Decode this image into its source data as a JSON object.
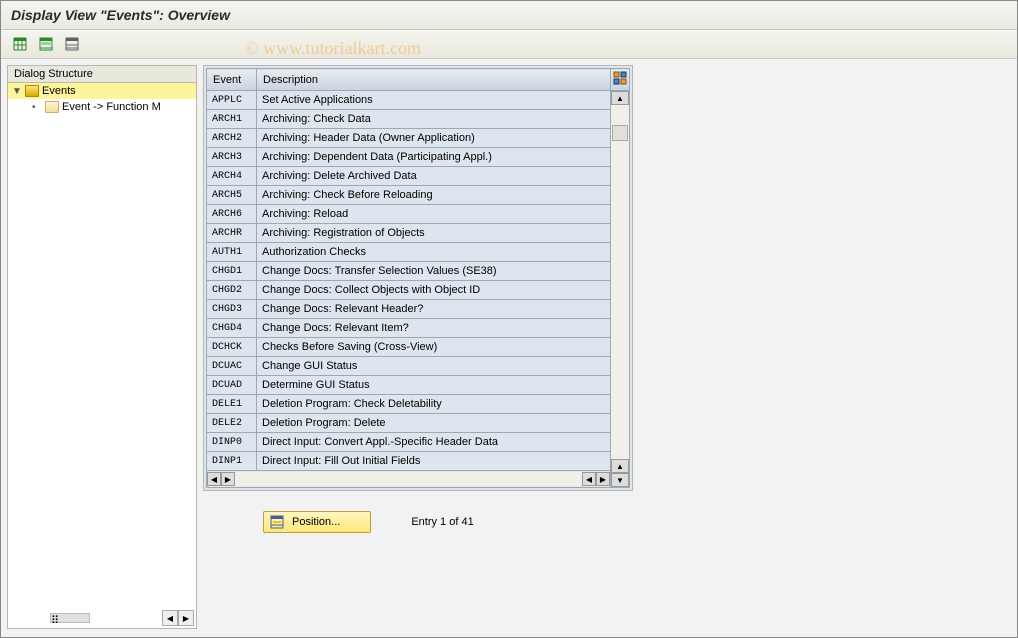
{
  "title": "Display View \"Events\": Overview",
  "watermark": "© www.tutorialkart.com",
  "dialog_structure": {
    "header": "Dialog Structure",
    "root": {
      "label": "Events",
      "expanded": true,
      "selected": true
    },
    "child": {
      "label": "Event -> Function M"
    }
  },
  "table": {
    "headers": {
      "event": "Event",
      "description": "Description"
    },
    "rows": [
      {
        "event": "APPLC",
        "desc": "Set Active Applications"
      },
      {
        "event": "ARCH1",
        "desc": "Archiving: Check Data"
      },
      {
        "event": "ARCH2",
        "desc": "Archiving: Header Data (Owner Application)"
      },
      {
        "event": "ARCH3",
        "desc": "Archiving: Dependent Data (Participating Appl.)"
      },
      {
        "event": "ARCH4",
        "desc": "Archiving: Delete Archived Data"
      },
      {
        "event": "ARCH5",
        "desc": "Archiving: Check Before Reloading"
      },
      {
        "event": "ARCH6",
        "desc": "Archiving: Reload"
      },
      {
        "event": "ARCHR",
        "desc": "Archiving: Registration of Objects"
      },
      {
        "event": "AUTH1",
        "desc": "Authorization Checks"
      },
      {
        "event": "CHGD1",
        "desc": "Change Docs: Transfer Selection Values (SE38)"
      },
      {
        "event": "CHGD2",
        "desc": "Change Docs: Collect Objects with Object ID"
      },
      {
        "event": "CHGD3",
        "desc": "Change Docs: Relevant Header?"
      },
      {
        "event": "CHGD4",
        "desc": "Change Docs: Relevant Item?"
      },
      {
        "event": "DCHCK",
        "desc": "Checks Before Saving (Cross-View)"
      },
      {
        "event": "DCUAC",
        "desc": "Change GUI Status"
      },
      {
        "event": "DCUAD",
        "desc": "Determine GUI Status"
      },
      {
        "event": "DELE1",
        "desc": "Deletion Program: Check Deletability"
      },
      {
        "event": "DELE2",
        "desc": "Deletion Program: Delete"
      },
      {
        "event": "DINP0",
        "desc": "Direct Input: Convert Appl.-Specific Header Data"
      },
      {
        "event": "DINP1",
        "desc": "Direct Input: Fill Out Initial Fields"
      }
    ]
  },
  "footer": {
    "position_label": "Position...",
    "status": "Entry 1 of 41"
  }
}
